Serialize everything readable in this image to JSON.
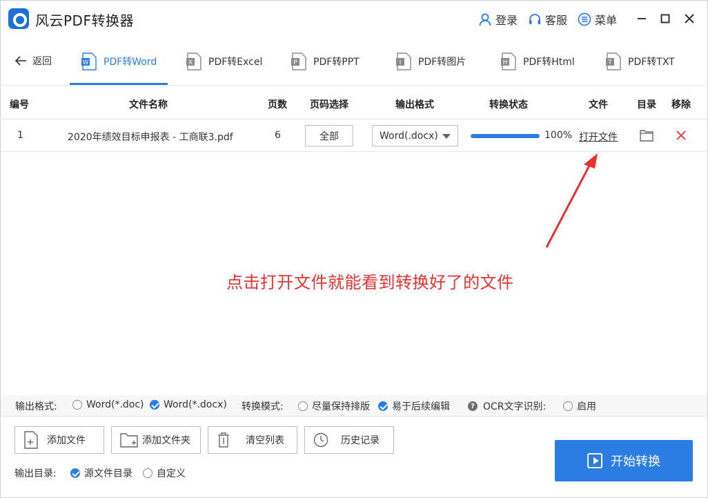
{
  "app": {
    "title": "风云PDF转换器"
  },
  "topbar": {
    "login": "登录",
    "service": "客服",
    "menu": "菜单"
  },
  "nav": {
    "back": "返回"
  },
  "tabs": [
    {
      "label": "PDF转Word",
      "badge": "W"
    },
    {
      "label": "PDF转Excel",
      "badge": "X"
    },
    {
      "label": "PDF转PPT",
      "badge": "P"
    },
    {
      "label": "PDF转图片",
      "badge": "I"
    },
    {
      "label": "PDF转Html",
      "badge": "H"
    },
    {
      "label": "PDF转TXT",
      "badge": "T"
    }
  ],
  "table": {
    "headers": [
      "编号",
      "文件名称",
      "页数",
      "页码选择",
      "输出格式",
      "转换状态",
      "文件",
      "目录",
      "移除"
    ],
    "rows": [
      {
        "index": "1",
        "filename": "2020年绩效目标申报表 - 工商联3.pdf",
        "pages": "6",
        "page_select": "全部",
        "format": "Word(.docx)",
        "progress": 100,
        "progress_label": "100%",
        "file_link": "打开文件"
      }
    ]
  },
  "annotation": "点击打开文件就能看到转换好了的文件",
  "options": {
    "output_format_label": "输出格式:",
    "fmt_doc": "Word(*.doc)",
    "fmt_docx": "Word(*.docx)",
    "mode_label": "转换模式:",
    "mode_keep": "尽量保持排版",
    "mode_edit": "易于后续编辑",
    "ocr_label": "OCR文字识别:",
    "ocr_enable": "启用"
  },
  "actions": {
    "add_file": "添加文件",
    "add_folder": "添加文件夹",
    "clear_list": "清空列表",
    "history": "历史记录",
    "start": "开始转换"
  },
  "output_dir": {
    "label": "输出目录:",
    "source": "源文件目录",
    "custom": "自定义"
  },
  "colors": {
    "accent": "#2a7de1",
    "annotation": "#e8322f"
  }
}
